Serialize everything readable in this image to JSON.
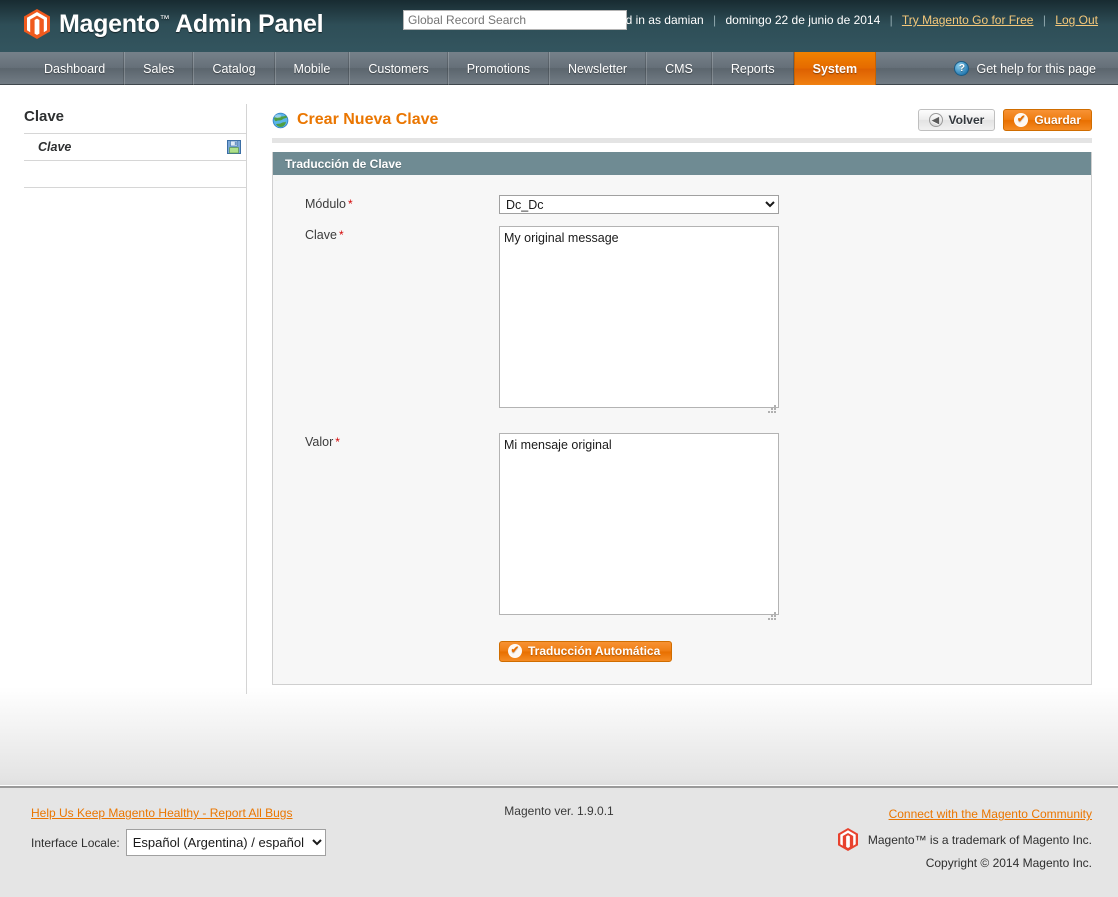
{
  "header": {
    "logo_text_1": "Magento",
    "logo_tm": "™",
    "logo_text_2": "Admin Panel",
    "logo_icon": "magento-logo-icon",
    "search_placeholder": "Global Record Search",
    "search_value": "",
    "logged_in_as": "Logged in as damian",
    "date": "domingo 22 de junio de 2014",
    "try_link": "Try Magento Go for Free",
    "logout_link": "Log Out",
    "separator": "|"
  },
  "nav": {
    "items": [
      {
        "label": "Dashboard",
        "active": false
      },
      {
        "label": "Sales",
        "active": false
      },
      {
        "label": "Catalog",
        "active": false
      },
      {
        "label": "Mobile",
        "active": false
      },
      {
        "label": "Customers",
        "active": false
      },
      {
        "label": "Promotions",
        "active": false
      },
      {
        "label": "Newsletter",
        "active": false
      },
      {
        "label": "CMS",
        "active": false
      },
      {
        "label": "Reports",
        "active": false
      },
      {
        "label": "System",
        "active": true
      }
    ],
    "help_text": "Get help for this page",
    "help_icon": "question-mark-icon",
    "help_glyph": "?"
  },
  "sidebar": {
    "title": "Clave",
    "items": [
      {
        "label": "Clave",
        "icon": "save-disk-icon"
      }
    ]
  },
  "content": {
    "page_icon": "globe-icon",
    "page_title": "Crear Nueva Clave",
    "buttons": {
      "back_label": "Volver",
      "back_icon": "back-arrow-icon",
      "back_glyph": "◀",
      "save_label": "Guardar",
      "save_icon": "check-circle-icon",
      "save_glyph": "✔"
    }
  },
  "form": {
    "panel_title": "Traducción de Clave",
    "required_marker": "*",
    "fields": {
      "module": {
        "label": "Módulo",
        "value": "Dc_Dc",
        "options": [
          "Dc_Dc"
        ]
      },
      "clave": {
        "label": "Clave",
        "value": "My original message",
        "spell_word_1": "My",
        "spell_word_2": "message",
        "plain_mid": " original "
      },
      "valor": {
        "label": "Valor",
        "value": "Mi mensaje original"
      }
    },
    "auto_translate": {
      "label": "Traducción Automática",
      "icon": "check-circle-icon",
      "glyph": "✔"
    }
  },
  "footer": {
    "report_bugs_link": "Help Us Keep Magento Healthy - Report All Bugs",
    "locale_label": "Interface Locale:",
    "locale_value": "Español (Argentina) / español (Argentina)",
    "locale_options": [
      "Español (Argentina) / español (Argentina)"
    ],
    "version": "Magento ver. 1.9.0.1",
    "community_link": "Connect with the Magento Community",
    "trademark": "Magento™ is a trademark of Magento Inc.",
    "copyright": "Copyright © 2014 Magento Inc.",
    "logo_icon": "magento-logo-icon"
  },
  "colors": {
    "header_bg": "#2e4e57",
    "nav_bg": "#656f78",
    "accent_orange": "#ea7601",
    "panel_head": "#6f8b93",
    "required_red": "#d40707",
    "link_gold": "#f5c87a"
  }
}
